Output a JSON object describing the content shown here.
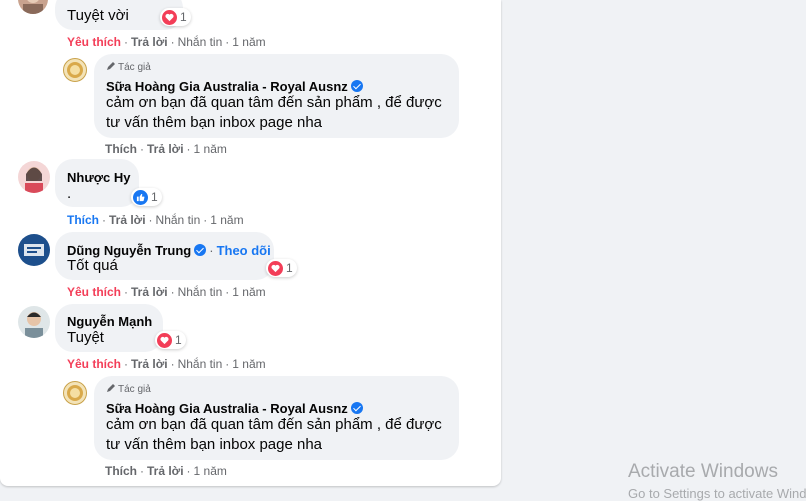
{
  "comments": [
    {
      "text": "Tuyệt vời",
      "reaction_count": "1",
      "actions": {
        "like": "Yêu thích",
        "reply": "Trả lời",
        "message": "Nhắn tin",
        "time": "1 năm"
      }
    },
    {
      "author_tag": "Tác giả",
      "name": "Sữa Hoàng Gia Australia - Royal Ausnz",
      "text_line1": "cảm ơn bạn đã quan tâm đến sản phẩm , để được",
      "text_line2": "tư vấn thêm bạn inbox page nha",
      "actions": {
        "like": "Thích",
        "reply": "Trả lời",
        "time": "1 năm"
      }
    },
    {
      "name": "Nhược Hy",
      "text": ".",
      "reaction_count": "1",
      "actions": {
        "like": "Thích",
        "reply": "Trả lời",
        "message": "Nhắn tin",
        "time": "1 năm"
      }
    },
    {
      "name": "Dũng Nguyễn Trung",
      "follow": "Theo dõi",
      "text": "Tốt quá",
      "reaction_count": "1",
      "actions": {
        "like": "Yêu thích",
        "reply": "Trả lời",
        "message": "Nhắn tin",
        "time": "1 năm"
      }
    },
    {
      "name": "Nguyễn Mạnh",
      "text": "Tuyệt",
      "reaction_count": "1",
      "actions": {
        "like": "Yêu thích",
        "reply": "Trả lời",
        "message": "Nhắn tin",
        "time": "1 năm"
      }
    },
    {
      "author_tag": "Tác giả",
      "name": "Sữa Hoàng Gia Australia - Royal Ausnz",
      "text_line1": "cảm ơn bạn đã quan tâm đến sản phẩm , để được",
      "text_line2": "tư vấn thêm bạn inbox page nha",
      "actions": {
        "like": "Thích",
        "reply": "Trả lời",
        "time": "1 năm"
      }
    }
  ],
  "watermark": {
    "title": "Activate Windows",
    "subtitle": "Go to Settings to activate Windows."
  },
  "colors": {
    "like_red": "#f33e58",
    "like_blue": "#1877f2",
    "bubble": "#f0f2f5",
    "meta_gray": "#65676b"
  }
}
